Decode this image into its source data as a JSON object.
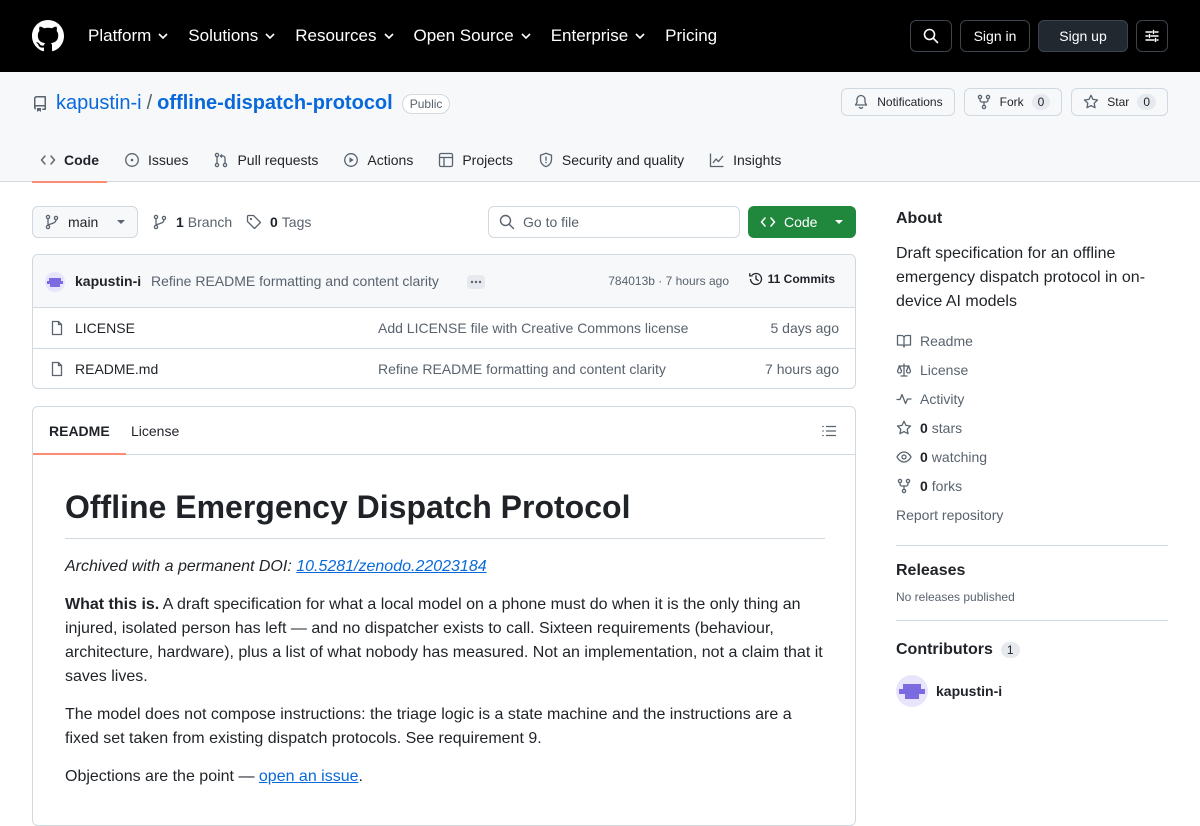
{
  "global_nav": {
    "items": [
      {
        "label": "Platform",
        "has_menu": true
      },
      {
        "label": "Solutions",
        "has_menu": true
      },
      {
        "label": "Resources",
        "has_menu": true
      },
      {
        "label": "Open Source",
        "has_menu": true
      },
      {
        "label": "Enterprise",
        "has_menu": true
      },
      {
        "label": "Pricing",
        "has_menu": false
      }
    ],
    "sign_in": "Sign in",
    "sign_up": "Sign up",
    "icons": {
      "logo": "github-mark-icon",
      "search": "search-icon",
      "menu": "sliders-icon"
    }
  },
  "repo": {
    "owner": "kapustin-i",
    "separator": "/",
    "name": "offline-dispatch-protocol",
    "visibility": "Public",
    "notifications_label": "Notifications",
    "fork_label": "Fork",
    "fork_count": "0",
    "star_label": "Star",
    "star_count": "0",
    "tabs": [
      {
        "label": "Code",
        "icon": "code-icon",
        "active": true
      },
      {
        "label": "Issues",
        "icon": "issue-opened-icon",
        "active": false
      },
      {
        "label": "Pull requests",
        "icon": "git-pull-request-icon",
        "active": false
      },
      {
        "label": "Actions",
        "icon": "play-icon",
        "active": false
      },
      {
        "label": "Projects",
        "icon": "table-icon",
        "active": false
      },
      {
        "label": "Security and quality",
        "icon": "shield-icon",
        "active": false
      },
      {
        "label": "Insights",
        "icon": "graph-icon",
        "active": false
      }
    ]
  },
  "file_browser": {
    "branch": "main",
    "branch_count": "1",
    "branch_label": "Branch",
    "tag_count": "0",
    "tag_label": "Tags",
    "go_to_file_placeholder": "Go to file",
    "code_button": "Code",
    "latest_commit": {
      "author": "kapustin-i",
      "message": "Refine README formatting and content clarity",
      "hash": "784013b",
      "time": "7 hours ago",
      "meta_sep": " · ",
      "commits_label": "11 Commits"
    },
    "files": [
      {
        "name": "LICENSE",
        "message": "Add LICENSE file with Creative Commons license",
        "time": "5 days ago"
      },
      {
        "name": "README.md",
        "message": "Refine README formatting and content clarity",
        "time": "7 hours ago"
      }
    ]
  },
  "readme": {
    "tabs": [
      "README",
      "License"
    ],
    "title": "Offline Emergency Dispatch Protocol",
    "doi_prefix": "Archived with a permanent DOI: ",
    "doi_link": "10.5281/zenodo.22023184",
    "p1_bold": "What this is.",
    "p1_text": " A draft specification for what a local model on a phone must do when it is the only thing an injured, isolated person has left — and no dispatcher exists to call. Sixteen requirements (behaviour, architecture, hardware), plus a list of what nobody has measured. Not an implementation, not a claim that it saves lives.",
    "p2": "The model does not compose instructions: the triage logic is a state machine and the instructions are a fixed set taken from existing dispatch protocols. See requirement 9.",
    "p3_prefix": "Objections are the point — ",
    "p3_link": "open an issue",
    "p3_suffix": "."
  },
  "sidebar": {
    "about_heading": "About",
    "description": "Draft specification for an offline emergency dispatch protocol in on-device AI models",
    "links": [
      {
        "icon": "book-icon",
        "label": "Readme"
      },
      {
        "icon": "law-icon",
        "label": "License"
      },
      {
        "icon": "pulse-icon",
        "label": "Activity"
      }
    ],
    "stars_count": "0",
    "stars_label": "stars",
    "watching_count": "0",
    "watching_label": "watching",
    "forks_count": "0",
    "forks_label": "forks",
    "report": "Report repository",
    "releases_heading": "Releases",
    "releases_text": "No releases published",
    "contributors_heading": "Contributors",
    "contributors_count": "1",
    "contributor_name": "kapustin-i"
  },
  "colors": {
    "header_bg": "#000000",
    "link_blue": "#0969da",
    "code_button_green": "#1f883d",
    "tab_underline": "#fd8c73",
    "avatar_purple": "#7a6be0"
  }
}
